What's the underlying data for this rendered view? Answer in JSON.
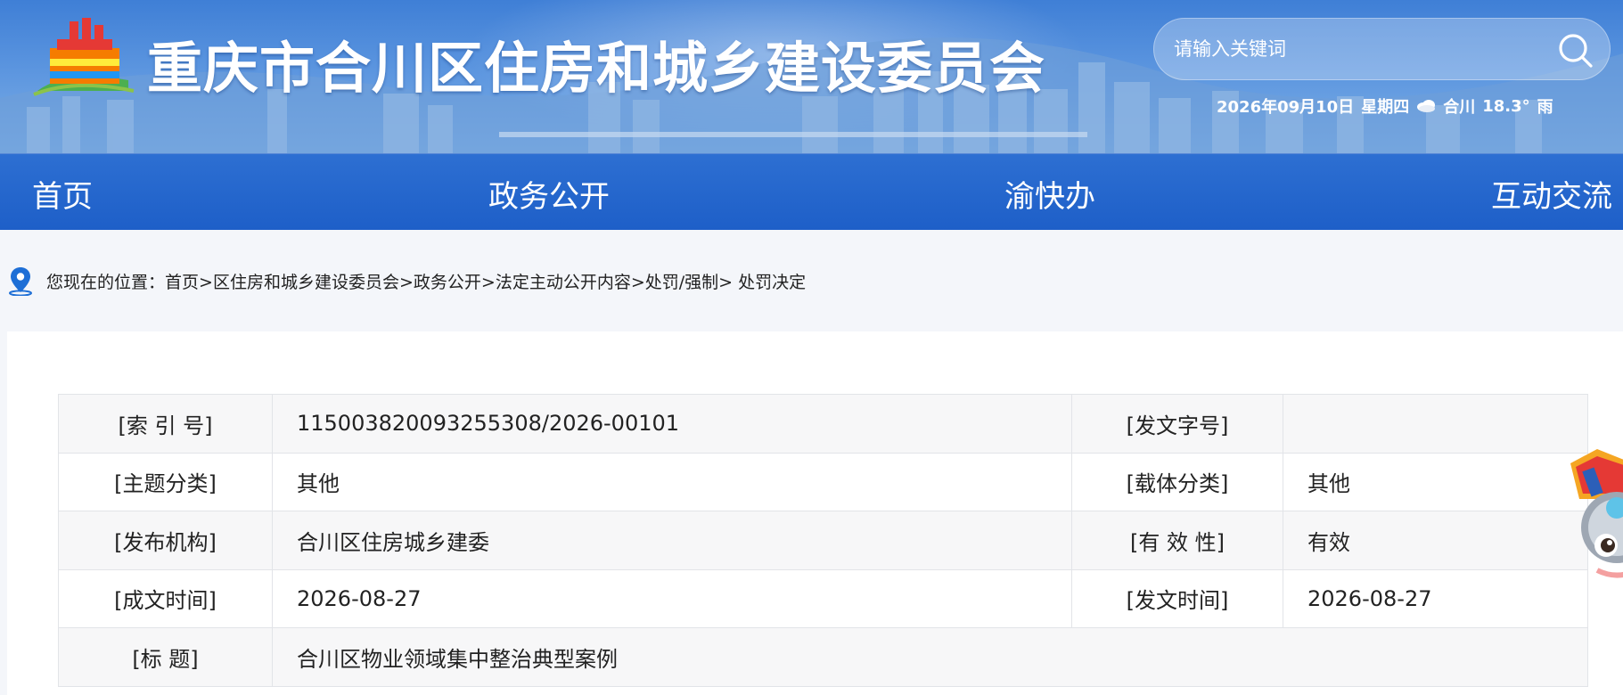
{
  "header": {
    "site_title": "重庆市合川区住房和城乡建设委员会",
    "search_placeholder": "请输入关键词",
    "weather": {
      "date": "2026年09月10日",
      "weekday": "星期四",
      "city": "合川",
      "temperature": "18.3°",
      "condition": "雨"
    }
  },
  "nav": {
    "items": [
      {
        "label": "首页"
      },
      {
        "label": "政务公开"
      },
      {
        "label": "渝快办"
      },
      {
        "label": "互动交流"
      }
    ]
  },
  "breadcrumb": {
    "prefix": "您现在的位置：",
    "items": [
      "首页",
      "区住房和城乡建设委员会",
      "政务公开",
      "法定主动公开内容",
      "处罚/强制",
      " 处罚决定"
    ],
    "separator": ">"
  },
  "document_meta": {
    "index_label": "[索 引 号]",
    "index_value": "115003820093255308/2026-00101",
    "doc_number_label": "[发文字号]",
    "doc_number_value": "",
    "topic_label": "[主题分类]",
    "topic_value": "其他",
    "carrier_label": "[载体分类]",
    "carrier_value": "其他",
    "publisher_label": "[发布机构]",
    "publisher_value": "合川区住房城乡建委",
    "validity_label": "[有 效 性]",
    "validity_value": "有效",
    "written_date_label": "[成文时间]",
    "written_date_value": "2026-08-27",
    "issued_date_label": "[发文时间]",
    "issued_date_value": "2026-08-27",
    "title_label": "[标 题]",
    "title_value": "合川区物业领域集中整治典型案例"
  },
  "colors": {
    "nav_bg": "#1e5fc8",
    "banner_top": "#3f7fd6",
    "table_border": "#e2e4e8",
    "page_bg": "#f4f6fa"
  }
}
